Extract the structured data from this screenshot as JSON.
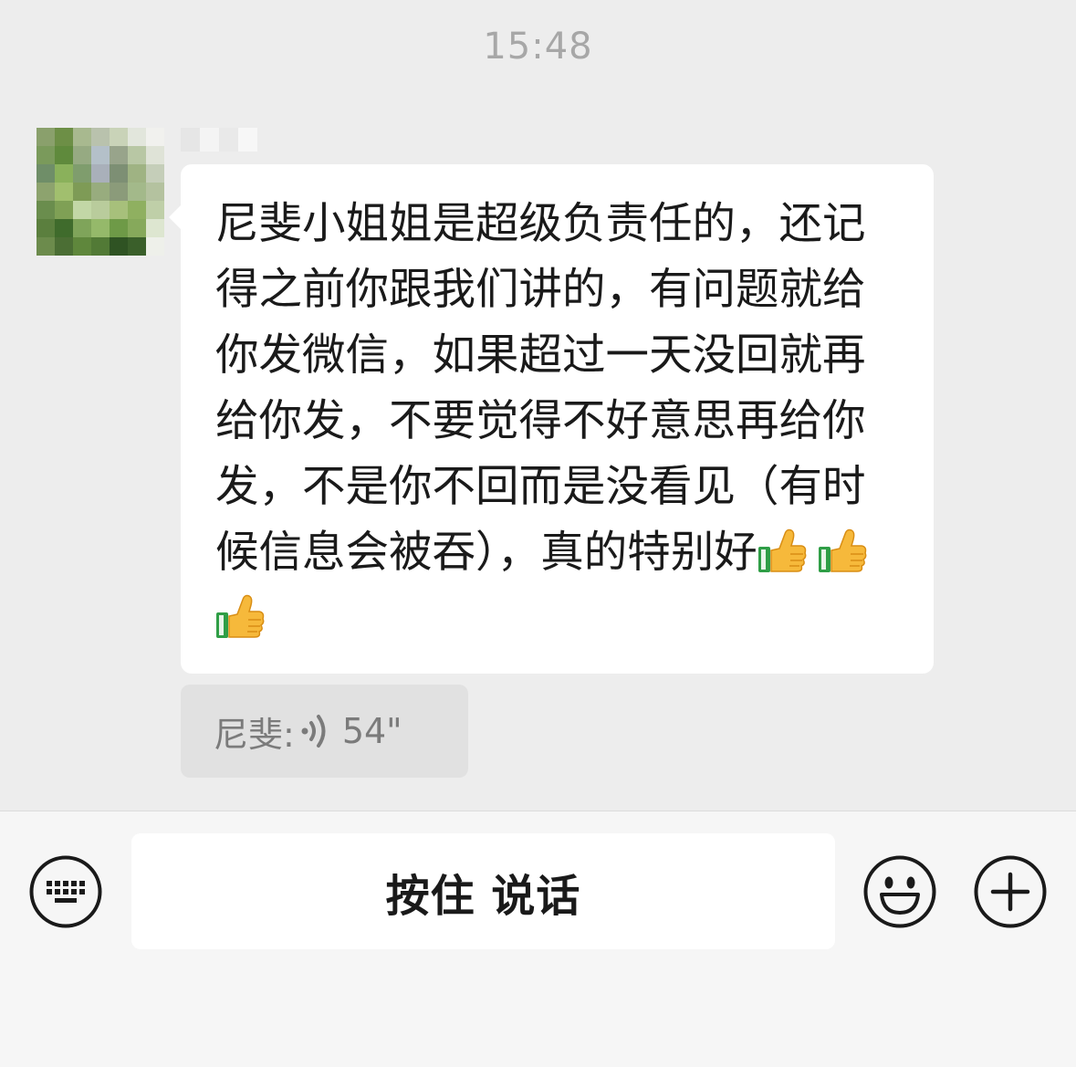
{
  "chat": {
    "timestamp": "15:48",
    "message": {
      "text": "尼斐小姐姐是超级负责任的，还记得之前你跟我们讲的，有问题就给你发微信，如果超过一天没回就再给你发，不要觉得不好意思再给你发，不是你不回而是没看见（有时候信息会被吞），真的特别好",
      "emoji": [
        "thumbs-up",
        "thumbs-up",
        "thumbs-up"
      ]
    },
    "quote": {
      "sender": "尼斐:",
      "duration": "54\""
    }
  },
  "input": {
    "hold_to_talk_label": "按住 说话",
    "icons": {
      "left": "keyboard-icon",
      "emoji": "smiley-icon",
      "more": "plus-icon"
    }
  },
  "colors": {
    "chat_background": "#ededed",
    "bubble_background": "#ffffff",
    "quote_background": "#e1e1e1",
    "input_bar_background": "#f6f6f6"
  }
}
